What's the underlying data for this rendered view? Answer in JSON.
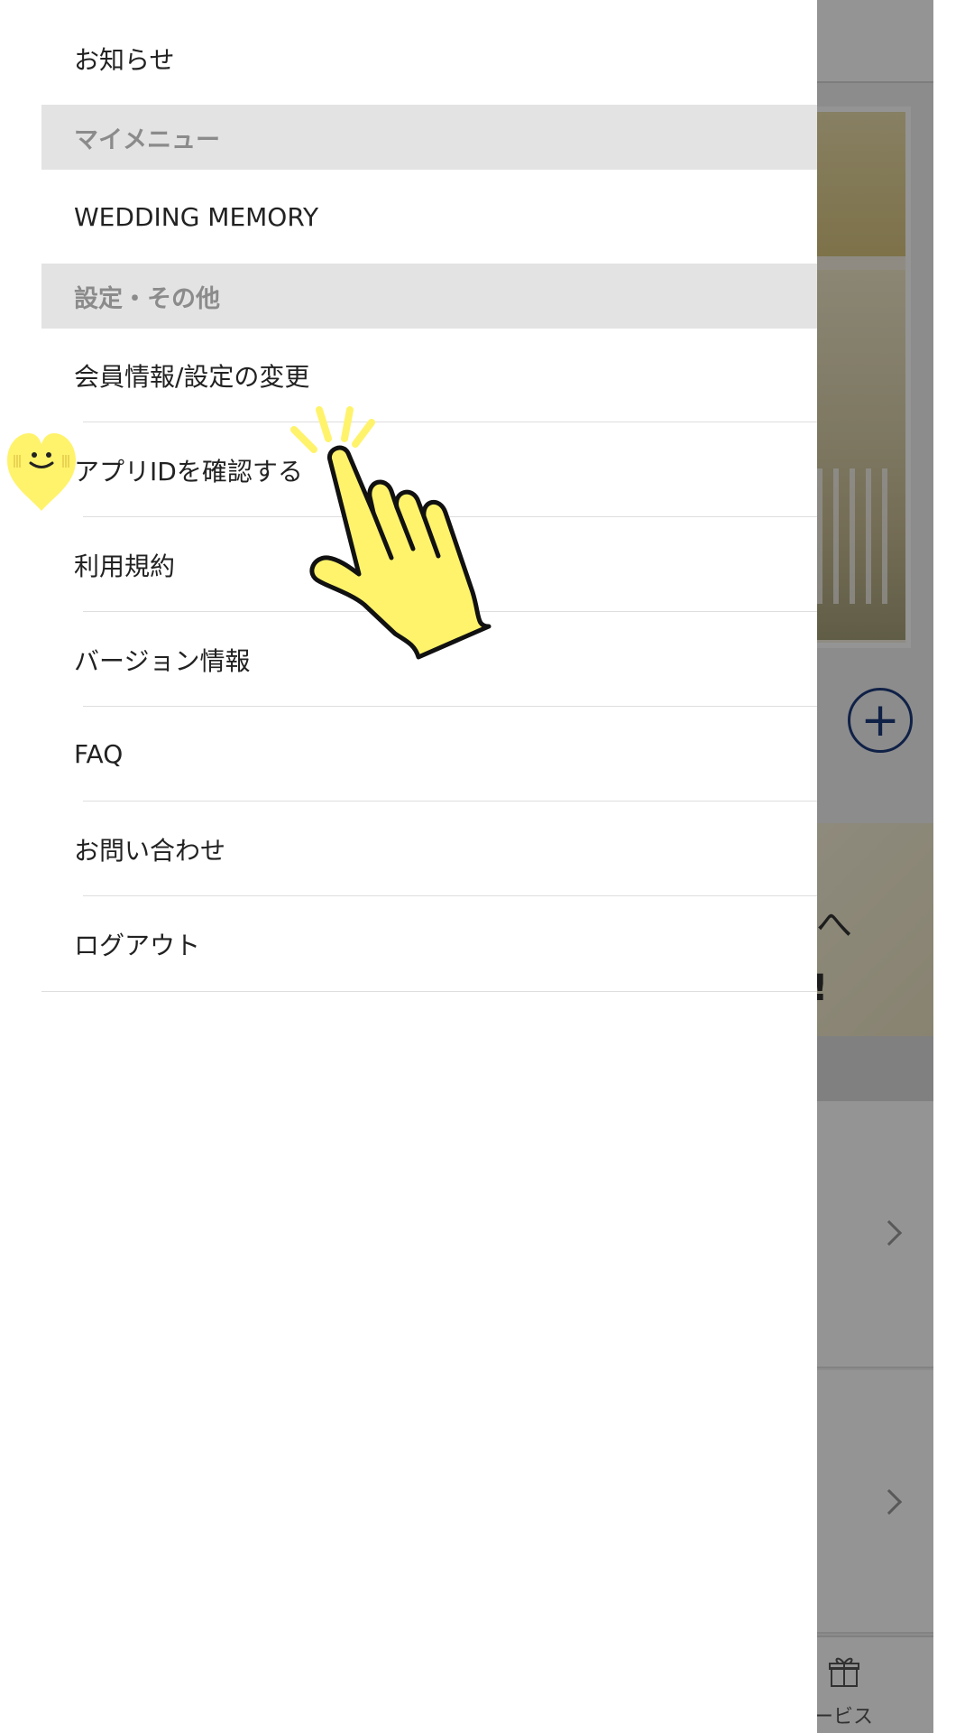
{
  "drawer": {
    "items": [
      {
        "type": "item",
        "label": "お知らせ"
      },
      {
        "type": "header",
        "label": "マイメニュー"
      },
      {
        "type": "item",
        "label": "WEDDING MEMORY"
      },
      {
        "type": "header",
        "label": "設定・その他"
      },
      {
        "type": "item",
        "label": "会員情報/設定の変更"
      },
      {
        "type": "item",
        "label": "アプリIDを確認する"
      },
      {
        "type": "item",
        "label": "利用規約"
      },
      {
        "type": "item",
        "label": "バージョン情報"
      },
      {
        "type": "item",
        "label": "FAQ"
      },
      {
        "type": "item",
        "label": "お問い合わせ"
      },
      {
        "type": "item",
        "label": "ログアウト"
      }
    ]
  },
  "background": {
    "add_button_icon": "plus-circle-icon",
    "banner_marks": [
      "へ",
      "!"
    ],
    "tab_icon": "gift-icon",
    "tab_label": "ービス"
  },
  "colors": {
    "accent": "#1d3a7a",
    "section_header_bg": "#e3e3e3",
    "section_header_text": "#8b8b8b",
    "highlight_yellow": "#fff36b"
  },
  "overlay": {
    "tap_hint_icon": "pointing-hand-icon",
    "sticker_icon": "smiling-heart-icon"
  }
}
